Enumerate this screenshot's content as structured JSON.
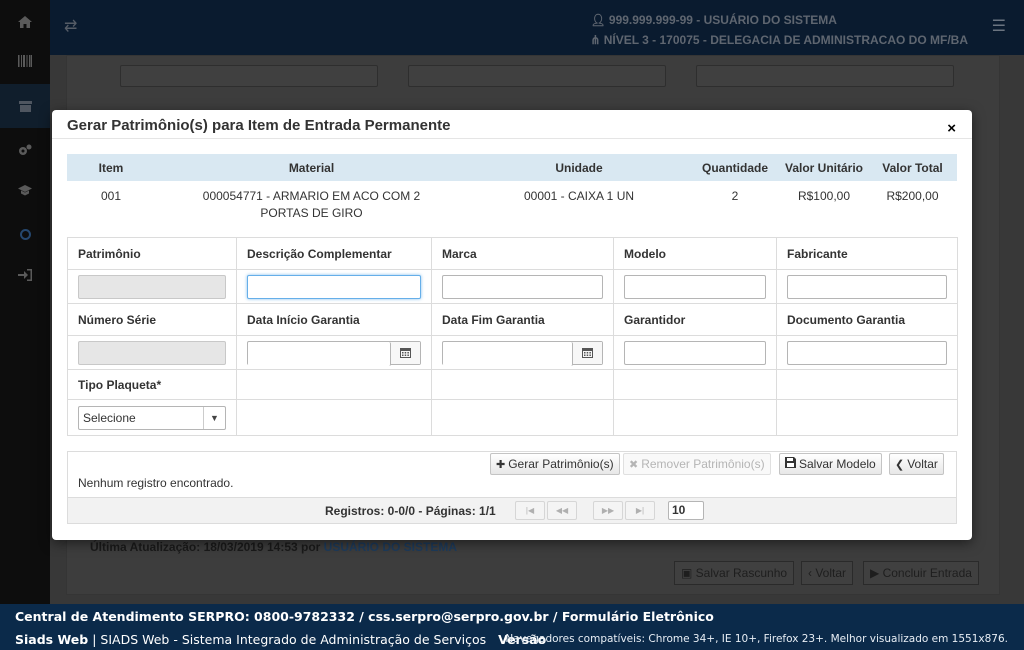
{
  "topbar": {
    "user_line": "999.999.999-99 - USUÁRIO DO SISTEMA",
    "level_line": "NÍVEL 3 - 170075 - DELEGACIA DE ADMINISTRACAO DO MF/BA"
  },
  "background": {
    "last_update_label": "Última Atualização: 18/03/2019 14:53 por",
    "last_update_user": "USUÁRIO DO SISTEMA",
    "buttons": [
      "Salvar Rascunho",
      "Voltar",
      "Concluir Entrada"
    ]
  },
  "modal": {
    "title": "Gerar Patrimônio(s) para Item de Entrada Permanente",
    "close_label": "×",
    "item_table": {
      "headers": [
        "Item",
        "Material",
        "Unidade",
        "Quantidade",
        "Valor Unitário",
        "Valor Total"
      ],
      "rows": [
        [
          "001",
          "000054771 - ARMARIO EM ACO COM 2 PORTAS DE GIRO",
          "00001 - CAIXA 1 UN",
          "2",
          "R$100,00",
          "R$200,00"
        ]
      ]
    },
    "form": {
      "patrimonio": "Patrimônio",
      "descricao": "Descrição Complementar",
      "marca": "Marca",
      "modelo": "Modelo",
      "fabricante": "Fabricante",
      "numero_serie": "Número Série",
      "data_inicio": "Data Início Garantia",
      "data_fim": "Data Fim Garantia",
      "garantidor": "Garantidor",
      "documento": "Documento Garantia",
      "tipo_plaqueta": "Tipo Plaqueta*",
      "tipo_plaqueta_value": "Selecione"
    },
    "actions": {
      "gerar": "Gerar Patrimônio(s)",
      "remover": "Remover Patrimônio(s)",
      "salvar_modelo": "Salvar Modelo",
      "voltar": "Voltar"
    },
    "empty_message": "Nenhum registro encontrado.",
    "pager": {
      "summary": "Registros: 0-0/0 - Páginas: 1/1",
      "page_size": "10"
    }
  },
  "footer": {
    "line1": "Central de Atendimento SERPRO: 0800-9782332 / css.serpro@serpro.gov.br / Formulário Eletrônico",
    "brand": "Siads Web",
    "system_name": "| SIADS Web - Sistema Integrado de Administração de Serviços",
    "version_label": "Versão",
    "compat": "Navegadores compatíveis: Chrome 34+, IE 10+, Firefox 23+. Melhor visualizado em 1551x876."
  }
}
